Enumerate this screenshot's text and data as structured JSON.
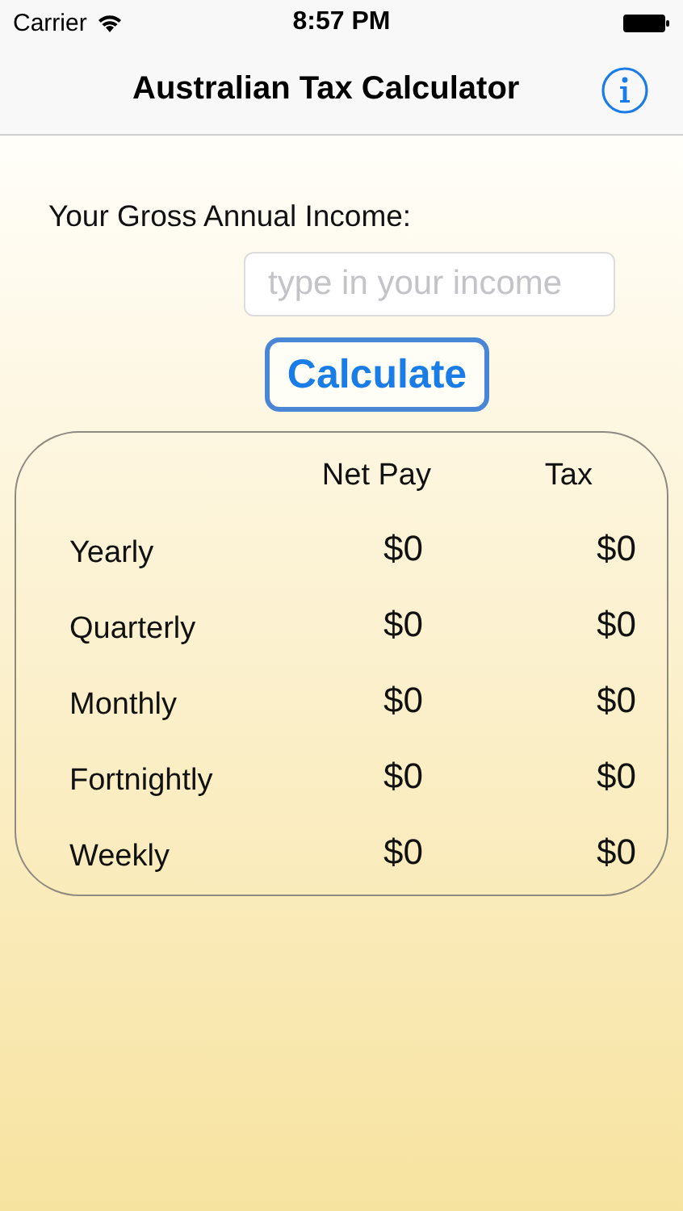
{
  "status_bar": {
    "carrier": "Carrier",
    "time": "8:57 PM"
  },
  "nav_bar": {
    "title": "Australian Tax Calculator"
  },
  "form": {
    "label": "Your Gross Annual Income:",
    "income_field": {
      "placeholder": "type in your income"
    },
    "button": "Calculate"
  },
  "table": {
    "columns": [
      "Net Pay",
      "Tax"
    ],
    "rows": [
      {
        "period": "Yearly",
        "net_pay": "$0",
        "tax": "$0"
      },
      {
        "period": "Quarterly",
        "net_pay": "$0",
        "tax": "$0"
      },
      {
        "period": "Monthly",
        "net_pay": "$0",
        "tax": "$0"
      },
      {
        "period": "Fortnightly",
        "net_pay": "$0",
        "tax": "$0"
      },
      {
        "period": "Weekly",
        "net_pay": "$0",
        "tax": "$0"
      }
    ]
  }
}
